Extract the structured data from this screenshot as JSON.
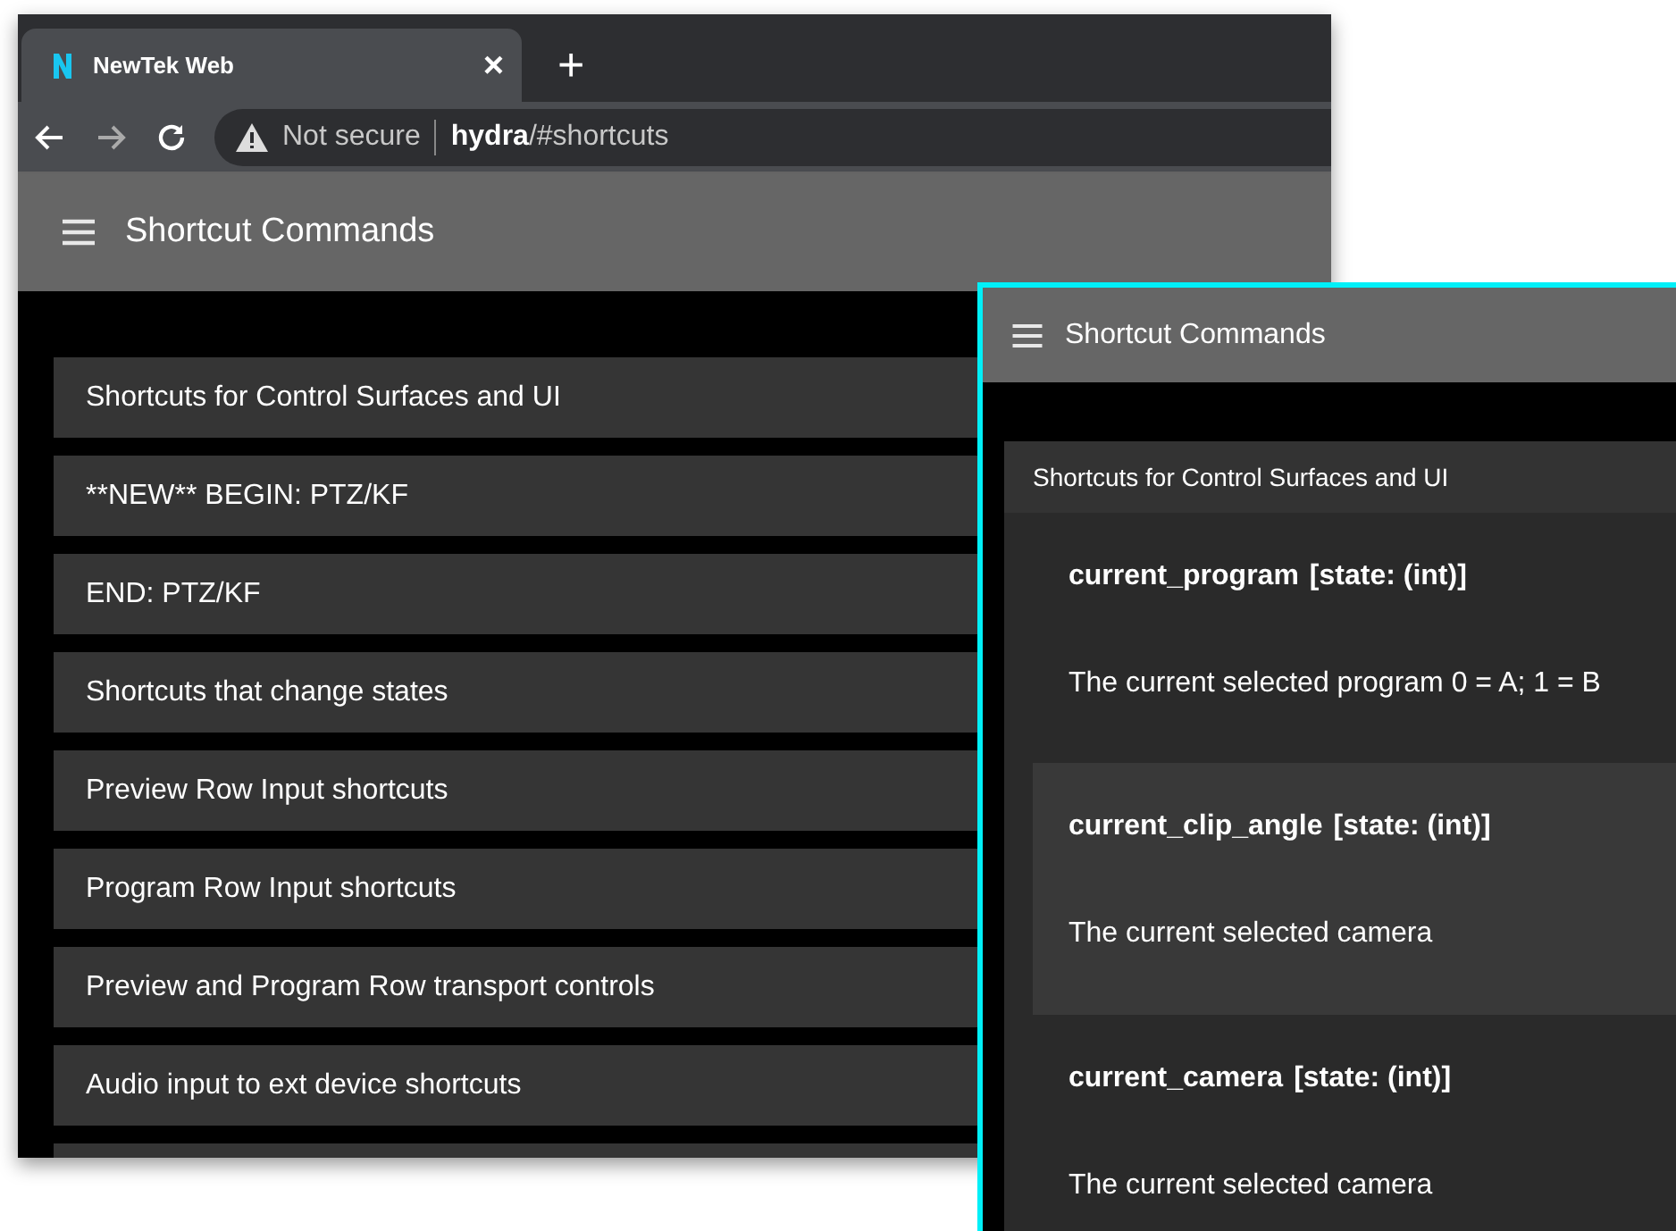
{
  "browser": {
    "tab": {
      "title": "NewTek Web",
      "close": "×"
    },
    "new_tab": "+",
    "address": {
      "security": "Not secure",
      "host": "hydra",
      "path": "/#shortcuts"
    },
    "app_bar": {
      "title": "Shortcut Commands"
    },
    "sections": [
      {
        "label": "Shortcuts for Control Surfaces and UI"
      },
      {
        "label": "**NEW** BEGIN: PTZ/KF"
      },
      {
        "label": "END: PTZ/KF"
      },
      {
        "label": "Shortcuts that change states"
      },
      {
        "label": "Preview Row Input shortcuts"
      },
      {
        "label": "Program Row Input shortcuts"
      },
      {
        "label": "Preview and Program Row transport controls"
      },
      {
        "label": "Audio input to ext device shortcuts"
      }
    ]
  },
  "detail": {
    "app_bar": {
      "title": "Shortcut Commands"
    },
    "section": {
      "label": "Shortcuts for Control Surfaces and UI",
      "items": [
        {
          "name": "current_program",
          "type": "[state: (int)]",
          "description": "The current selected program 0 = A; 1 = B",
          "selected": false
        },
        {
          "name": "current_clip_angle",
          "type": "[state: (int)]",
          "description": "The current selected camera",
          "selected": true
        },
        {
          "name": "current_camera",
          "type": "[state: (int)]",
          "description": "The current selected camera",
          "selected": false
        }
      ]
    }
  }
}
